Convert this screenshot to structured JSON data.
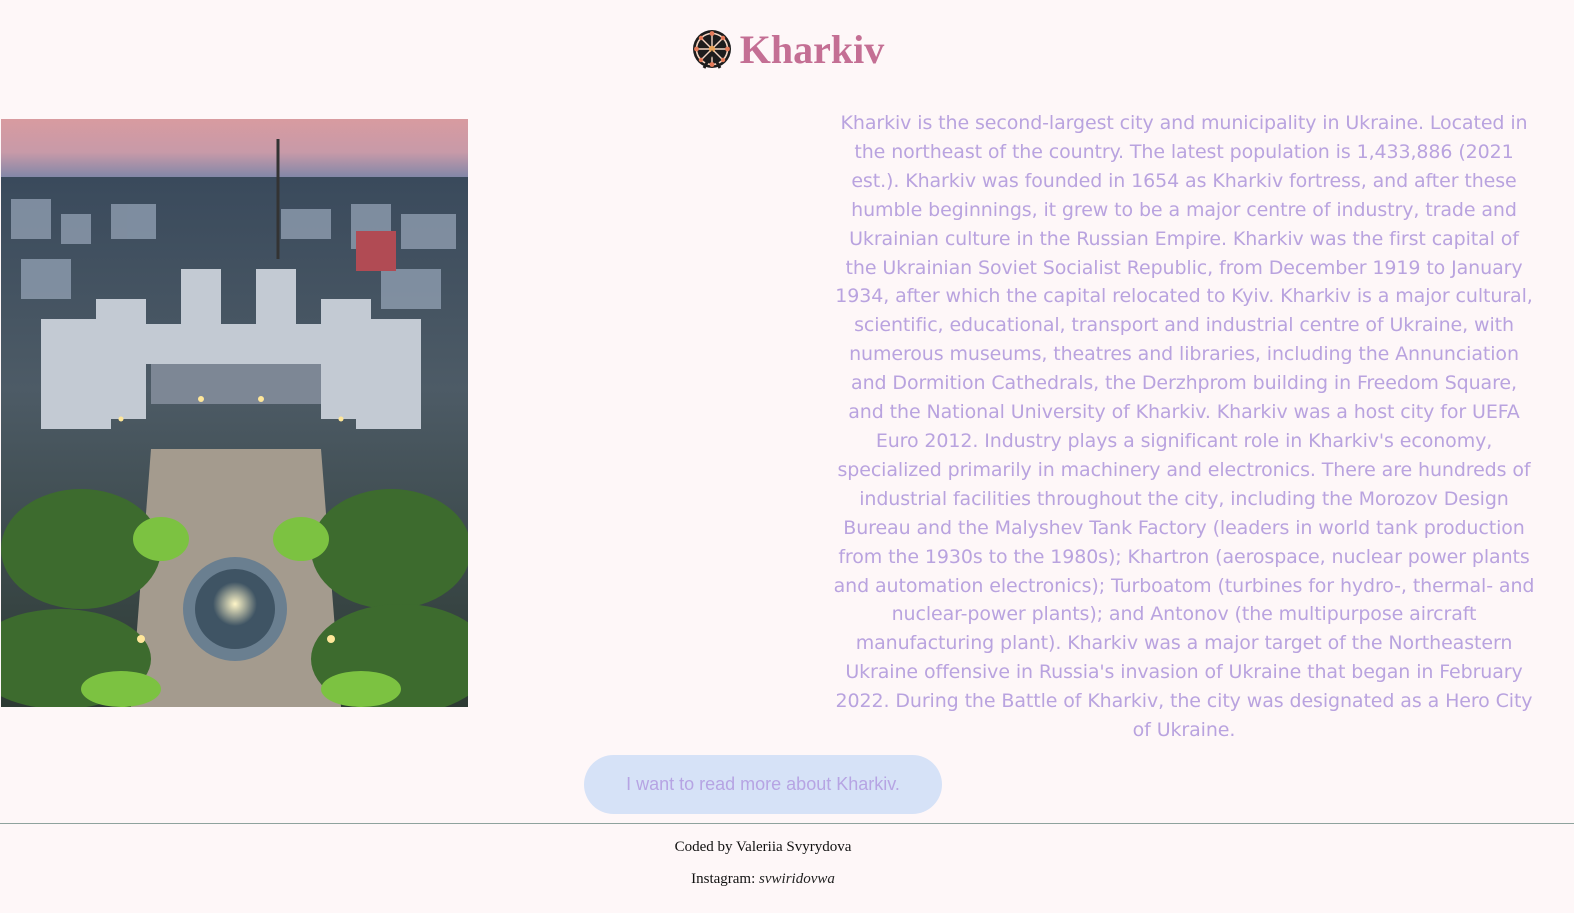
{
  "header": {
    "title": "Kharkiv",
    "logo_icon": "ferris-wheel-icon"
  },
  "photo": {
    "alt": "Kharkiv"
  },
  "description": "Kharkiv is the second-largest city and municipality in Ukraine. Located in the northeast of the country. The latest population is 1,433,886 (2021 est.). Kharkiv was founded in 1654 as Kharkiv fortress, and after these humble beginnings, it grew to be a major centre of industry, trade and Ukrainian culture in the Russian Empire. Kharkiv was the first capital of the Ukrainian Soviet Socialist Republic, from December 1919 to January 1934, after which the capital relocated to Kyiv. Kharkiv is a major cultural, scientific, educational, transport and industrial centre of Ukraine, with numerous museums, theatres and libraries, including the Annunciation and Dormition Cathedrals, the Derzhprom building in Freedom Square, and the National University of Kharkiv. Kharkiv was a host city for UEFA Euro 2012. Industry plays a significant role in Kharkiv's economy, specialized primarily in machinery and electronics. There are hundreds of industrial facilities throughout the city, including the Morozov Design Bureau and the Malyshev Tank Factory (leaders in world tank production from the 1930s to the 1980s); Khartron (aerospace, nuclear power plants and automation electronics); Turboatom (turbines for hydro-, thermal- and nuclear-power plants); and Antonov (the multipurpose aircraft manufacturing plant). Kharkiv was a major target of the Northeastern Ukraine offensive in Russia's invasion of Ukraine that began in February 2022. During the Battle of Kharkiv, the city was designated as a Hero City of Ukraine.",
  "read_more_button": "I want to read more about Kharkiv.",
  "footer": {
    "credit": "Coded by Valeriia Svyrydova",
    "instagram_label": "Instagram:",
    "instagram_handle": "svwiridovwa"
  },
  "colors": {
    "background": "#fef7f8",
    "title": "#c46f94",
    "text": "#b9a3df",
    "button_bg": "#d6e2f7",
    "button_text": "#b6a4e3"
  }
}
